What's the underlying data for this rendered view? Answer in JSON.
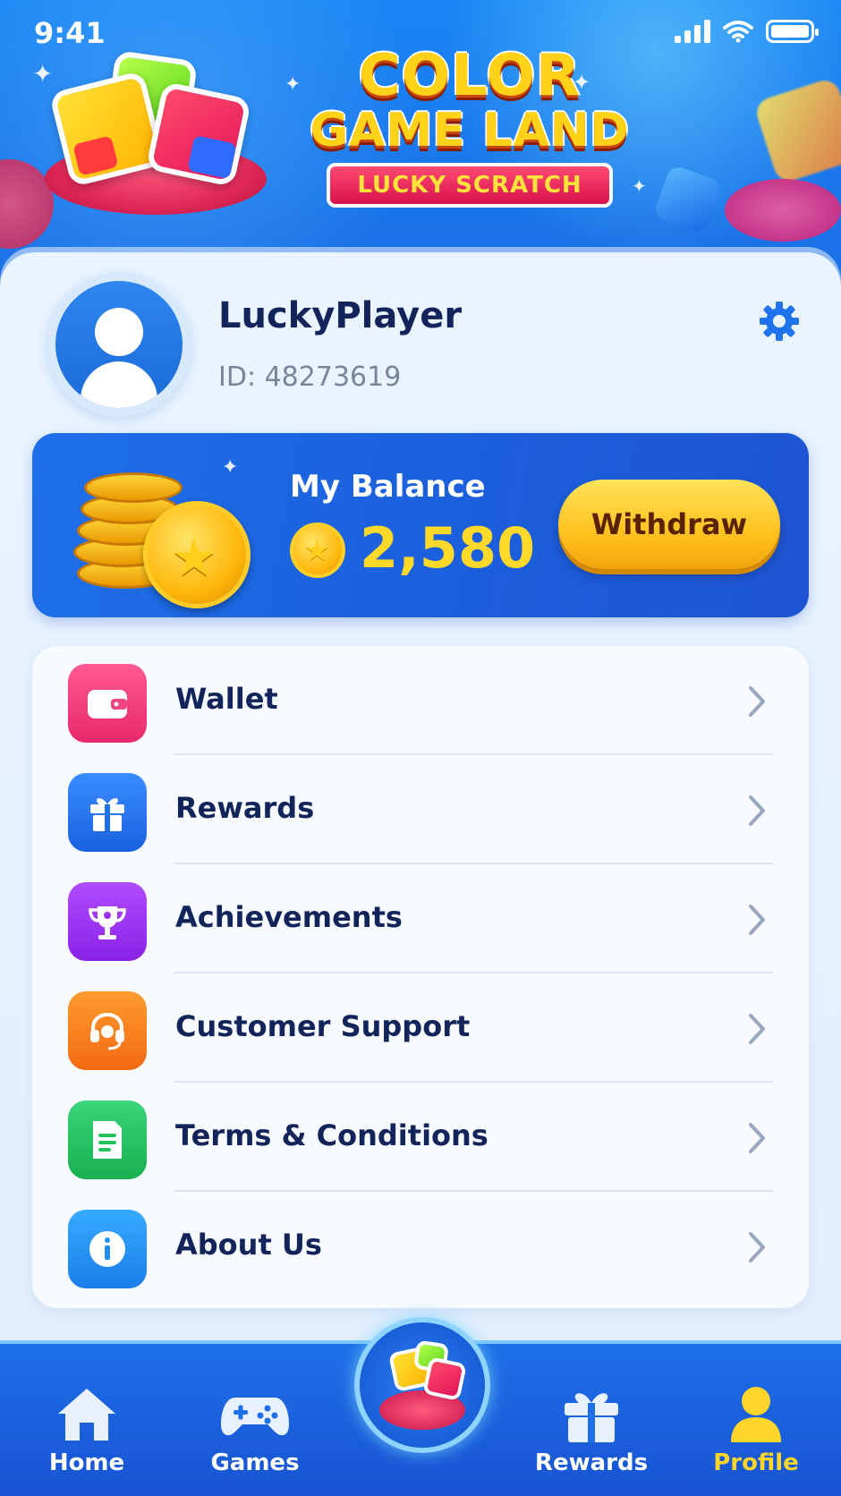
{
  "status_bar": {
    "time": "9:41"
  },
  "header": {
    "logo_line1": "COLOR",
    "logo_line2": "GAME LAND",
    "logo_ribbon": "LUCKY SCRATCH"
  },
  "profile": {
    "username": "LuckyPlayer",
    "id_text": "ID: 48273619"
  },
  "balance": {
    "label": "My Balance",
    "value": "2,580",
    "withdraw_label": "Withdraw"
  },
  "menu": {
    "items": [
      {
        "label": "Wallet",
        "icon": "wallet-icon",
        "color": "#f23e7a"
      },
      {
        "label": "Rewards",
        "icon": "gift-icon",
        "color": "#1f74ee"
      },
      {
        "label": "Achievements",
        "icon": "trophy-icon",
        "color": "#9a2ff0"
      },
      {
        "label": "Customer Support",
        "icon": "headset-icon",
        "color": "#ff7a1f"
      },
      {
        "label": "Terms & Conditions",
        "icon": "document-icon",
        "color": "#22c25f"
      },
      {
        "label": "About Us",
        "icon": "info-icon",
        "color": "#1e8ff2"
      }
    ]
  },
  "bottom_nav": {
    "items": [
      {
        "label": "Home",
        "icon": "home-icon",
        "active": false
      },
      {
        "label": "Games",
        "icon": "gamepad-icon",
        "active": false
      },
      {
        "label": "Rewards",
        "icon": "gift-icon",
        "active": false
      },
      {
        "label": "Profile",
        "icon": "person-icon",
        "active": true
      }
    ]
  },
  "colors": {
    "accent": "#1f6fe8",
    "gold": "#ffd92a",
    "text_dark": "#13245a",
    "active_nav": "#ffd52a"
  }
}
